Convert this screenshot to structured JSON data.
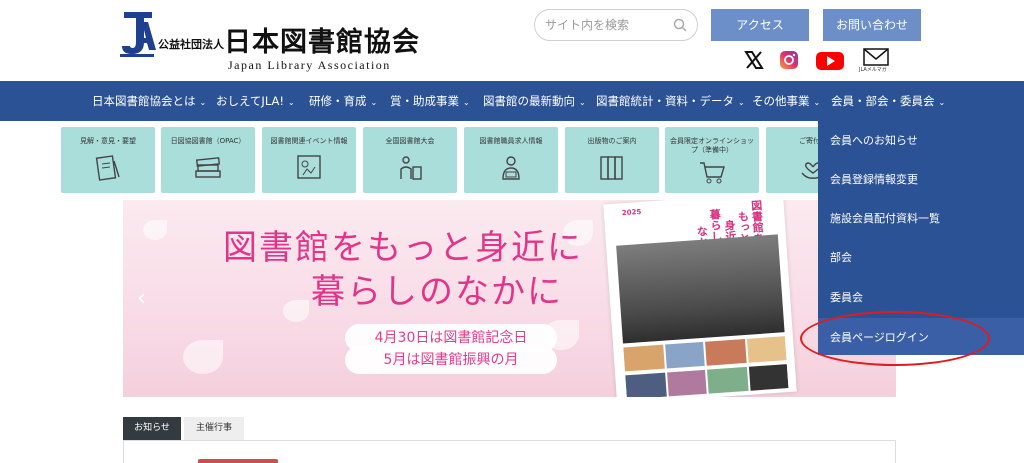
{
  "header": {
    "logo_org_type": "公益社団法人",
    "logo_name": "日本図書館協会",
    "logo_english": "Japan Library Association",
    "search_placeholder": "サイト内を検索",
    "access_label": "アクセス",
    "contact_label": "お問い合わせ",
    "mail_label": "JLAメルマガ"
  },
  "nav": {
    "items": [
      {
        "label": "日本図書館協会とは"
      },
      {
        "label": "おしえてJLA!"
      },
      {
        "label": "研修・育成"
      },
      {
        "label": "賞・助成事業"
      },
      {
        "label": "図書館の最新動向"
      },
      {
        "label": "図書館統計・資料・データ"
      },
      {
        "label": "その他事業"
      },
      {
        "label": "会員・部会・委員会"
      }
    ]
  },
  "quick_links": [
    {
      "label": "見解・意見・要望"
    },
    {
      "label": "日図協図書館（OPAC）"
    },
    {
      "label": "図書館関連イベント情報"
    },
    {
      "label": "全国図書館大会"
    },
    {
      "label": "図書館職員求人情報"
    },
    {
      "label": "出版物のご案内"
    },
    {
      "label": "会員限定オンラインショップ（準備中）"
    },
    {
      "label": "ご寄付の"
    }
  ],
  "banner": {
    "line1": "図書館をもっと身近に",
    "line2": "暮らしのなかに",
    "pill1": "4月30日は図書館記念日",
    "pill2": "5月は図書館振興の月",
    "poster_year": "2025",
    "poster_lines": [
      "図書館を",
      "もっと",
      "身近に",
      "暮らしの",
      "なかに"
    ]
  },
  "tabs": [
    {
      "label": "お知らせ",
      "active": true
    },
    {
      "label": "主催行事",
      "active": false
    }
  ],
  "dropdown": {
    "items": [
      {
        "label": "会員へのお知らせ"
      },
      {
        "label": "会員登録情報変更"
      },
      {
        "label": "施設会員配付資料一覧"
      },
      {
        "label": "部会"
      },
      {
        "label": "委員会"
      },
      {
        "label": "会員ページログイン"
      }
    ],
    "highlighted": "会員ページログイン"
  },
  "colors": {
    "nav_bg": "#2c5296",
    "header_button": "#6c8fc9",
    "quick_link_bg": "#a9dedb",
    "banner_text": "#e2358a",
    "highlight_ring": "#e01b1b"
  }
}
